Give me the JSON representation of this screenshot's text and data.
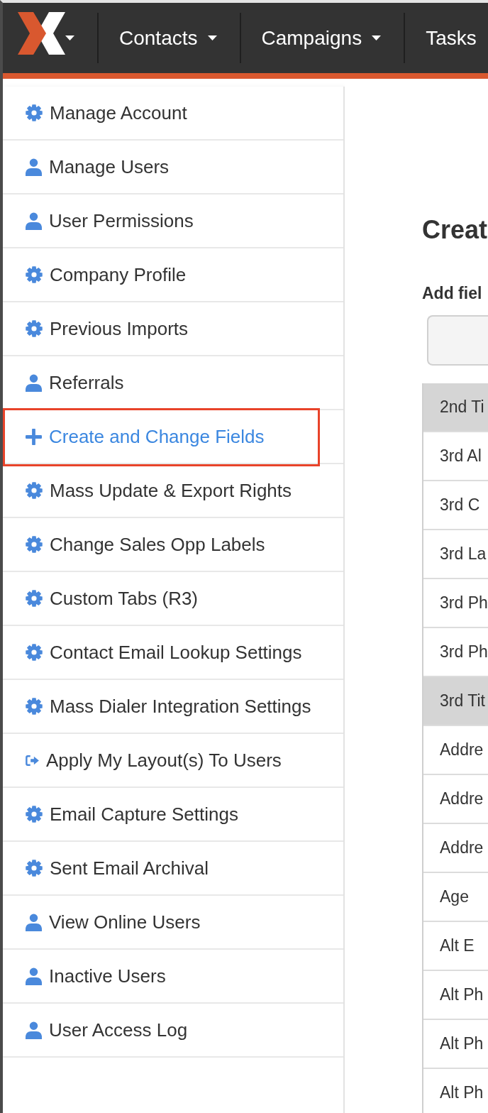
{
  "navbar": {
    "brand": {
      "dropdown": true
    },
    "menus": [
      {
        "label": "Contacts",
        "dropdown": true
      },
      {
        "label": "Campaigns",
        "dropdown": true
      },
      {
        "label": "Tasks",
        "dropdown": false
      }
    ]
  },
  "sidebar": {
    "items": [
      {
        "label": "Manage Account",
        "kind": "setting",
        "selected": false,
        "outlined": false
      },
      {
        "label": "Manage Users",
        "kind": "user",
        "selected": false,
        "outlined": false
      },
      {
        "label": "User Permissions",
        "kind": "user",
        "selected": false,
        "outlined": false
      },
      {
        "label": "Company Profile",
        "kind": "setting",
        "selected": false,
        "outlined": false
      },
      {
        "label": "Previous Imports",
        "kind": "setting",
        "selected": false,
        "outlined": false
      },
      {
        "label": "Referrals",
        "kind": "user",
        "selected": false,
        "outlined": false
      },
      {
        "label": "Create and Change Fields",
        "kind": "add",
        "selected": true,
        "outlined": true
      },
      {
        "label": "Mass Update & Export Rights",
        "kind": "setting",
        "selected": false,
        "outlined": false
      },
      {
        "label": "Change Sales Opp Labels",
        "kind": "setting",
        "selected": false,
        "outlined": false
      },
      {
        "label": "Custom Tabs (R3)",
        "kind": "setting",
        "selected": false,
        "outlined": false
      },
      {
        "label": "Contact Email Lookup Settings",
        "kind": "setting",
        "selected": false,
        "outlined": false
      },
      {
        "label": "Mass Dialer Integration Settings",
        "kind": "setting",
        "selected": false,
        "outlined": false
      },
      {
        "label": "Apply My Layout(s) To Users",
        "kind": "apply",
        "selected": false,
        "outlined": false
      },
      {
        "label": "Email Capture Settings",
        "kind": "setting",
        "selected": false,
        "outlined": false
      },
      {
        "label": "Sent Email Archival",
        "kind": "setting",
        "selected": false,
        "outlined": false
      },
      {
        "label": "View Online Users",
        "kind": "user",
        "selected": false,
        "outlined": false
      },
      {
        "label": "Inactive Users",
        "kind": "user",
        "selected": false,
        "outlined": false
      },
      {
        "label": "User Access Log",
        "kind": "user",
        "selected": false,
        "outlined": false
      }
    ]
  },
  "main": {
    "heading": "Creat",
    "field_label": "Add fiel",
    "rows": [
      {
        "label": "2nd Ti",
        "shaded": true
      },
      {
        "label": "3rd Al",
        "shaded": false
      },
      {
        "label": "3rd C",
        "shaded": false
      },
      {
        "label": "3rd La",
        "shaded": false
      },
      {
        "label": "3rd Ph",
        "shaded": false
      },
      {
        "label": "3rd Ph",
        "shaded": false
      },
      {
        "label": "3rd Tit",
        "shaded": true
      },
      {
        "label": "Addre",
        "shaded": false
      },
      {
        "label": "Addre",
        "shaded": false
      },
      {
        "label": "Addre",
        "shaded": false
      },
      {
        "label": "Age",
        "shaded": false
      },
      {
        "label": "Alt E",
        "shaded": false
      },
      {
        "label": "Alt Ph",
        "shaded": false
      },
      {
        "label": "Alt Ph",
        "shaded": false
      },
      {
        "label": "Alt Ph",
        "shaded": false
      }
    ]
  }
}
